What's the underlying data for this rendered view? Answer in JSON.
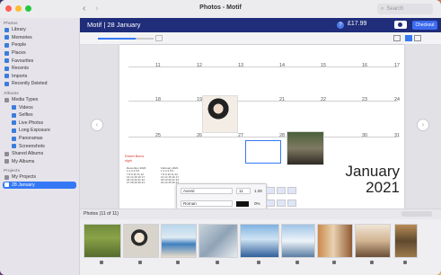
{
  "window": {
    "title": "Photos - Motif",
    "search_placeholder": "Search"
  },
  "sidebar": {
    "photos_header": "Photos",
    "photos_items": [
      "Library",
      "Memories",
      "People",
      "Places",
      "Favourites",
      "Recents",
      "Imports",
      "Recently Deleted"
    ],
    "albums_header": "Albums",
    "media_types": "Media Types",
    "media_items": [
      "Videos",
      "Selfies",
      "Live Photos",
      "Long Exposure",
      "Panoramas",
      "Screenshots"
    ],
    "shared_albums": "Shared Albums",
    "my_albums": "My Albums",
    "projects_header": "Projects",
    "my_projects": "My Projects",
    "selected_project": "28 January"
  },
  "project_bar": {
    "title": "Motif | 28 January",
    "price": "£17.99",
    "checkout_label": "Checkout",
    "help_icon": "?"
  },
  "calendar": {
    "rows": [
      [
        "11",
        "12",
        "13",
        "14",
        "15",
        "16",
        "17"
      ],
      [
        "18",
        "19",
        "20",
        "21",
        "22",
        "23",
        "24"
      ],
      [
        "25",
        "26",
        "27",
        "28",
        "29",
        "30",
        "31"
      ]
    ],
    "month": "January",
    "year": "2021",
    "note_line1": "Robert Burns",
    "note_line2": "night",
    "mini_prev": "December 2020",
    "mini_next": "February 2021"
  },
  "format_panel": {
    "font1": "Avenir",
    "size1": "11",
    "spacing1": "1.00",
    "font2": "Roman",
    "opacity": "0%"
  },
  "photos_strip": {
    "count_label": "Photos (11 of 11)",
    "photos": [
      "p1",
      "p2",
      "p3",
      "p4",
      "p5",
      "p6",
      "p7",
      "p8",
      "p9"
    ]
  },
  "icons": {
    "back": "‹",
    "forward": "›",
    "search": "⌕"
  }
}
